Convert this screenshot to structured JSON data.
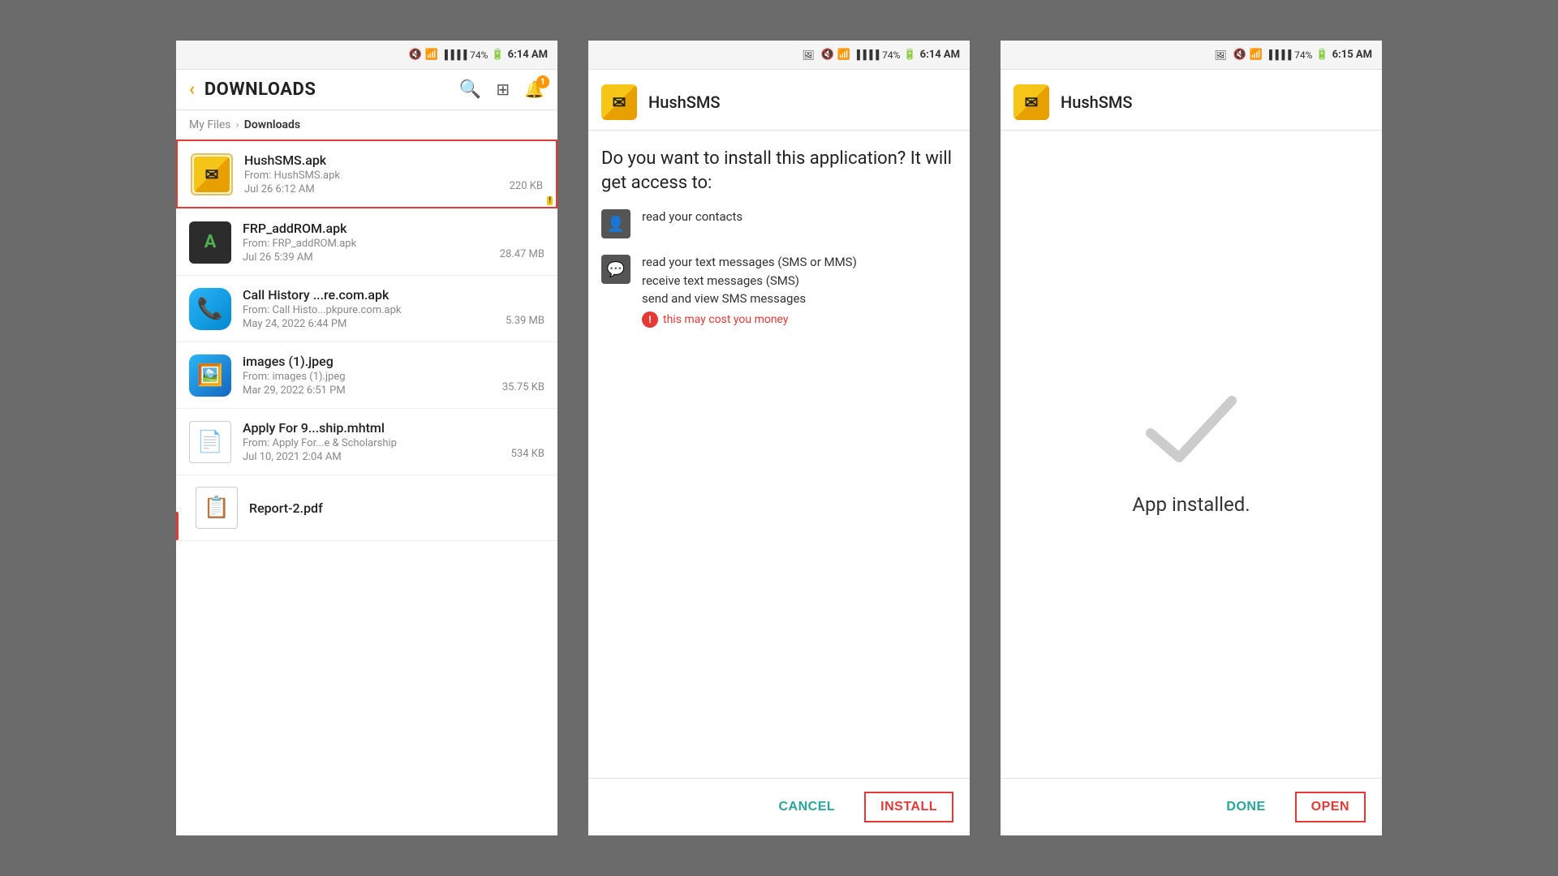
{
  "screen1": {
    "status_bar": {
      "battery": "74%",
      "time": "6:14 AM"
    },
    "title": "DOWNLOADS",
    "breadcrumb_root": "My Files",
    "breadcrumb_current": "Downloads",
    "files": [
      {
        "name": "HushSMS.apk",
        "source": "From: HushSMS.apk",
        "date": "Jul 26 6:12 AM",
        "size": "220 KB",
        "selected": true,
        "icon_type": "hushsms"
      },
      {
        "name": "FRP_addROM.apk",
        "source": "From: FRP_addROM.apk",
        "date": "Jul 26 5:39 AM",
        "size": "28.47 MB",
        "selected": false,
        "icon_type": "frp"
      },
      {
        "name": "Call History ...re.com.apk",
        "source": "From: Call Histo...pkpure.com.apk",
        "date": "May 24, 2022 6:44 PM",
        "size": "5.39 MB",
        "selected": false,
        "icon_type": "call"
      },
      {
        "name": "images (1).jpeg",
        "source": "From: images (1).jpeg",
        "date": "Mar 29, 2022 6:51 PM",
        "size": "35.75 KB",
        "selected": false,
        "icon_type": "img"
      },
      {
        "name": "Apply For 9...ship.mhtml",
        "source": "From: Apply For...e & Scholarship",
        "date": "Jul 10, 2021 2:04 AM",
        "size": "534 KB",
        "selected": false,
        "icon_type": "doc"
      },
      {
        "name": "Report-2.pdf",
        "source": "",
        "date": "",
        "size": "",
        "selected": false,
        "icon_type": "pdf_partial"
      }
    ]
  },
  "screen2": {
    "status_bar": {
      "battery": "74%",
      "time": "6:14 AM"
    },
    "app_name": "HushSMS",
    "install_question": "Do you want to install this application? It will get access to:",
    "permissions": [
      {
        "icon": "contact",
        "text": "read your contacts"
      },
      {
        "icon": "sms",
        "text": "read your text messages (SMS or MMS)\nreceive text messages (SMS)\nsend and view SMS messages",
        "warning": "this may cost you money"
      }
    ],
    "btn_cancel": "CANCEL",
    "btn_install": "INSTALL"
  },
  "screen3": {
    "status_bar": {
      "battery": "74%",
      "time": "6:15 AM"
    },
    "app_name": "HushSMS",
    "installed_text": "App installed.",
    "btn_done": "DONE",
    "btn_open": "OPEN"
  }
}
